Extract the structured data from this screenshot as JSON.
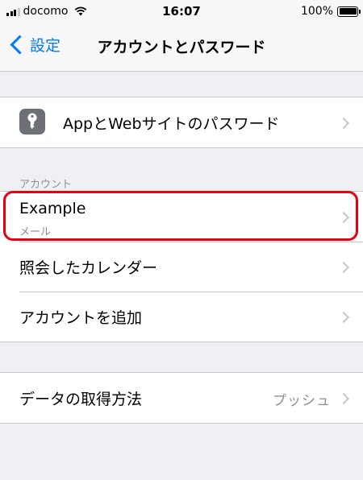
{
  "status_bar": {
    "carrier": "docomo",
    "time": "16:07",
    "battery": "100%"
  },
  "nav": {
    "back_label": "設定",
    "title": "アカウントとパスワード"
  },
  "passwords_row": {
    "label": "AppとWebサイトのパスワード",
    "icon": "key-icon"
  },
  "accounts_section": {
    "header": "アカウント",
    "items": [
      {
        "title": "Example",
        "subtitle": "メール"
      },
      {
        "title": "照会したカレンダー"
      },
      {
        "title": "アカウントを追加"
      }
    ]
  },
  "fetch_row": {
    "label": "データの取得方法",
    "value": "プッシュ"
  },
  "colors": {
    "accent": "#007aff",
    "highlight": "#e60012",
    "background": "#efeff4"
  }
}
